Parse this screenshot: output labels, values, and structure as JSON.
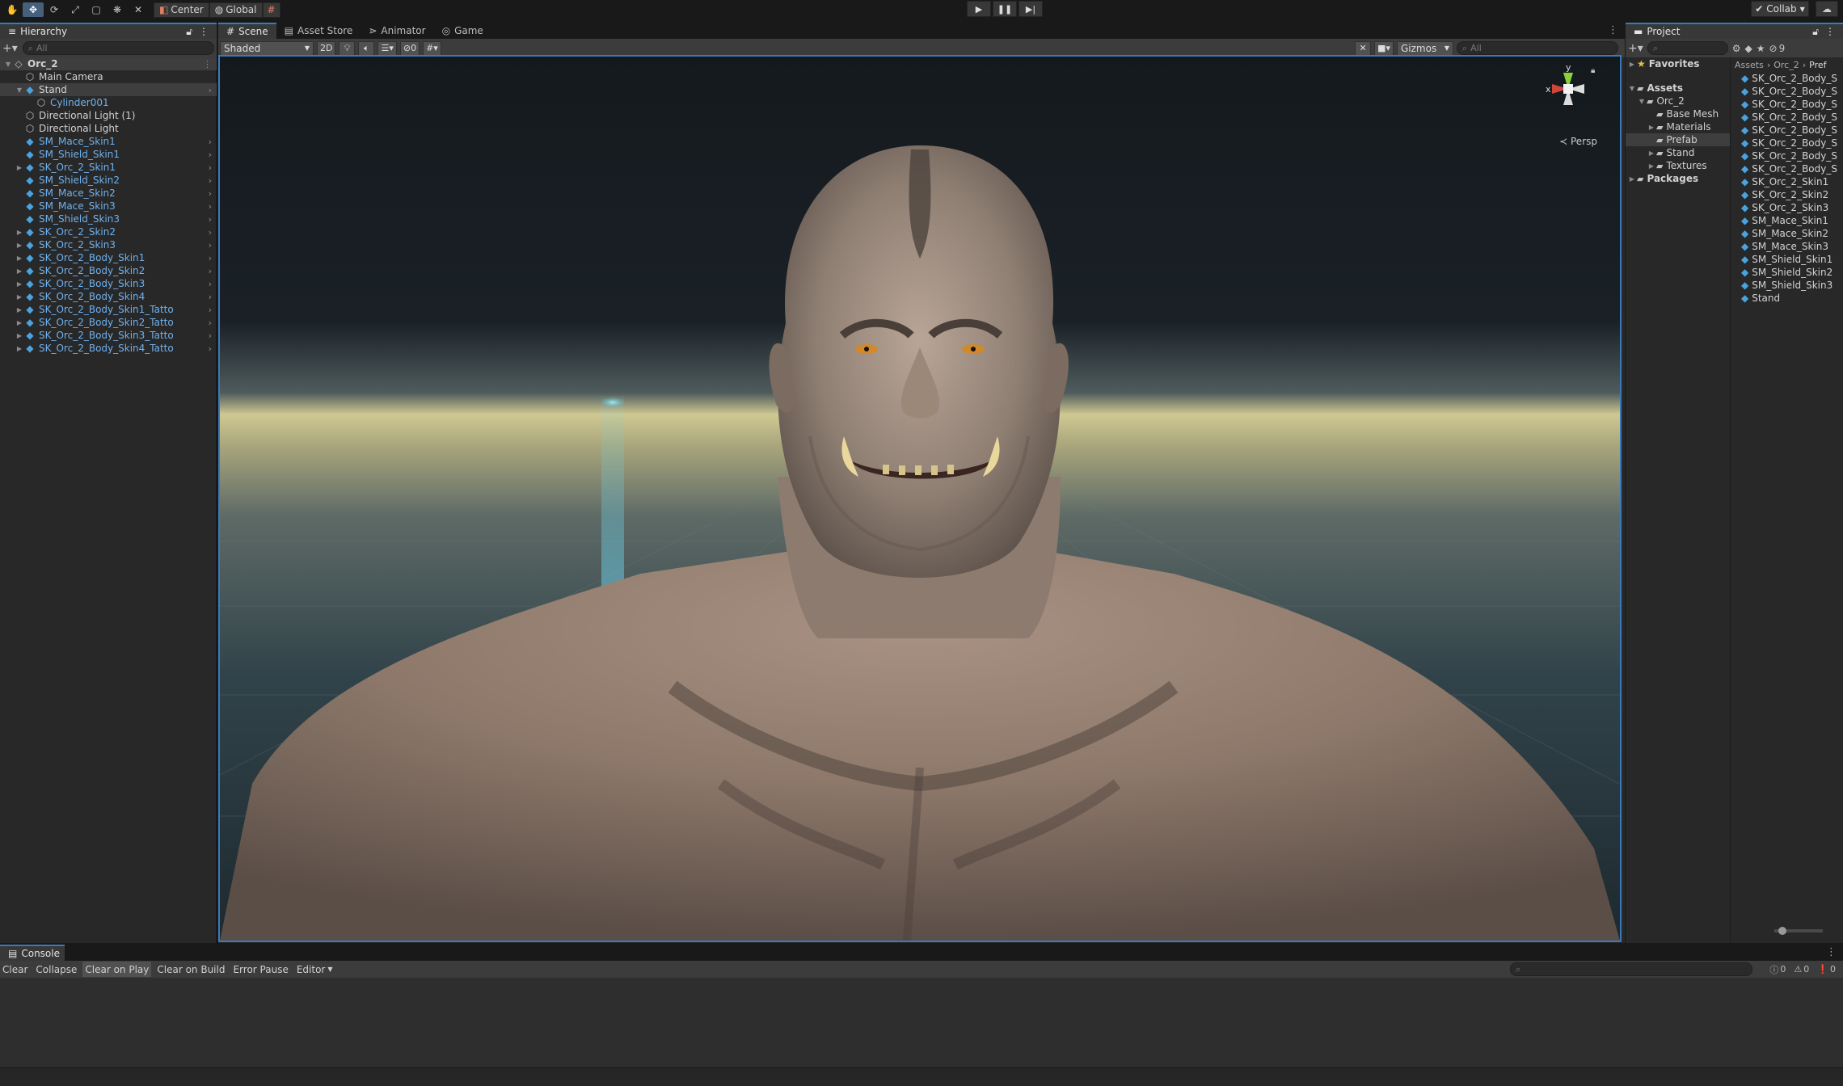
{
  "toolbar": {
    "pivot_mode": "Center",
    "pivot_rotation": "Global",
    "collab_label": "Collab"
  },
  "hierarchy": {
    "tab_label": "Hierarchy",
    "search_placeholder": "All",
    "items": [
      {
        "label": "Orc_2",
        "depth": 0,
        "expanded": true,
        "kind": "scene"
      },
      {
        "label": "Main Camera",
        "depth": 1,
        "kind": "grey"
      },
      {
        "label": "Stand",
        "depth": 1,
        "expanded": true,
        "kind": "blue-white",
        "chevron": true
      },
      {
        "label": "Cylinder001",
        "depth": 2,
        "kind": "grey-blue"
      },
      {
        "label": "Directional Light (1)",
        "depth": 1,
        "kind": "grey"
      },
      {
        "label": "Directional Light",
        "depth": 1,
        "kind": "grey"
      },
      {
        "label": "SM_Mace_Skin1",
        "depth": 1,
        "kind": "blue",
        "chevron": true
      },
      {
        "label": "SM_Shield_Skin1",
        "depth": 1,
        "kind": "blue",
        "chevron": true
      },
      {
        "label": "SK_Orc_2_Skin1",
        "depth": 1,
        "kind": "blue",
        "collapsed": true,
        "chevron": true
      },
      {
        "label": "SM_Shield_Skin2",
        "depth": 1,
        "kind": "blue",
        "chevron": true
      },
      {
        "label": "SM_Mace_Skin2",
        "depth": 1,
        "kind": "blue",
        "chevron": true
      },
      {
        "label": "SM_Mace_Skin3",
        "depth": 1,
        "kind": "blue",
        "chevron": true
      },
      {
        "label": "SM_Shield_Skin3",
        "depth": 1,
        "kind": "blue",
        "chevron": true
      },
      {
        "label": "SK_Orc_2_Skin2",
        "depth": 1,
        "kind": "blue",
        "collapsed": true,
        "chevron": true
      },
      {
        "label": "SK_Orc_2_Skin3",
        "depth": 1,
        "kind": "blue",
        "collapsed": true,
        "chevron": true
      },
      {
        "label": "SK_Orc_2_Body_Skin1",
        "depth": 1,
        "kind": "blue",
        "collapsed": true,
        "chevron": true
      },
      {
        "label": "SK_Orc_2_Body_Skin2",
        "depth": 1,
        "kind": "blue",
        "collapsed": true,
        "chevron": true
      },
      {
        "label": "SK_Orc_2_Body_Skin3",
        "depth": 1,
        "kind": "blue",
        "collapsed": true,
        "chevron": true
      },
      {
        "label": "SK_Orc_2_Body_Skin4",
        "depth": 1,
        "kind": "blue",
        "collapsed": true,
        "chevron": true
      },
      {
        "label": "SK_Orc_2_Body_Skin1_Tatto",
        "depth": 1,
        "kind": "blue",
        "collapsed": true,
        "chevron": true
      },
      {
        "label": "SK_Orc_2_Body_Skin2_Tatto",
        "depth": 1,
        "kind": "blue",
        "collapsed": true,
        "chevron": true
      },
      {
        "label": "SK_Orc_2_Body_Skin3_Tatto",
        "depth": 1,
        "kind": "blue",
        "collapsed": true,
        "chevron": true
      },
      {
        "label": "SK_Orc_2_Body_Skin4_Tatto",
        "depth": 1,
        "kind": "blue",
        "collapsed": true,
        "chevron": true
      }
    ]
  },
  "scene": {
    "tabs": [
      {
        "label": "Scene",
        "icon": "grid-icon",
        "active": true
      },
      {
        "label": "Asset Store",
        "icon": "store-icon"
      },
      {
        "label": "Animator",
        "icon": "animator-icon"
      },
      {
        "label": "Game",
        "icon": "gamepad-icon"
      }
    ],
    "shading_mode": "Shaded",
    "mode_2d": "2D",
    "hidden_count": "0",
    "gizmos_label": "Gizmos",
    "search_placeholder": "All",
    "gizmo_x_label": "x",
    "gizmo_y_label": "y",
    "projection_label": "Persp"
  },
  "project": {
    "tab_label": "Project",
    "favorites_label": "Favorites",
    "assets_label": "Assets",
    "packages_label": "Packages",
    "layer_count": "9",
    "tree": [
      {
        "label": "Orc_2",
        "depth": 1,
        "expanded": true
      },
      {
        "label": "Base Mesh",
        "depth": 2
      },
      {
        "label": "Materials",
        "depth": 2,
        "collapsed": true
      },
      {
        "label": "Prefab",
        "depth": 2,
        "selected": true
      },
      {
        "label": "Stand",
        "depth": 2,
        "collapsed": true
      },
      {
        "label": "Textures",
        "depth": 2,
        "collapsed": true
      }
    ],
    "breadcrumb": [
      "Assets",
      "Orc_2",
      "Pref"
    ],
    "files": [
      "SK_Orc_2_Body_S",
      "SK_Orc_2_Body_S",
      "SK_Orc_2_Body_S",
      "SK_Orc_2_Body_S",
      "SK_Orc_2_Body_S",
      "SK_Orc_2_Body_S",
      "SK_Orc_2_Body_S",
      "SK_Orc_2_Body_S",
      "SK_Orc_2_Skin1",
      "SK_Orc_2_Skin2",
      "SK_Orc_2_Skin3",
      "SM_Mace_Skin1",
      "SM_Mace_Skin2",
      "SM_Mace_Skin3",
      "SM_Shield_Skin1",
      "SM_Shield_Skin2",
      "SM_Shield_Skin3",
      "Stand"
    ]
  },
  "console": {
    "tab_label": "Console",
    "clear": "Clear",
    "collapse": "Collapse",
    "clear_on_play": "Clear on Play",
    "clear_on_build": "Clear on Build",
    "error_pause": "Error Pause",
    "editor": "Editor",
    "log_count": "0",
    "warning_count": "0",
    "error_count": "0"
  },
  "colors": {
    "accent": "#3a79bb",
    "hierarchy_blue": "#6fb1ee",
    "panel_bg": "#282828",
    "toolbar_bg": "#3c3c3c"
  }
}
